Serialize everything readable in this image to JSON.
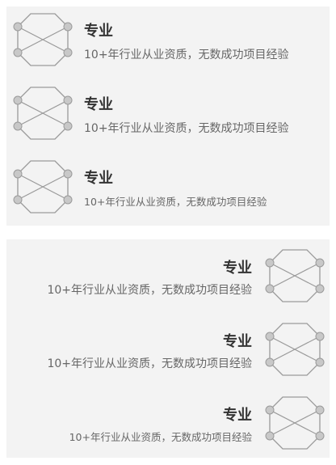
{
  "top_panel": {
    "items": [
      {
        "title": "专业",
        "desc": "10+年行业从业资质，无数成功项目经验"
      },
      {
        "title": "专业",
        "desc": "10+年行业从业资质，无数成功项目经验"
      },
      {
        "title": "专业",
        "desc": "10+年行业从业资质，无数成功项目经验"
      }
    ]
  },
  "bottom_panel": {
    "items": [
      {
        "title": "专业",
        "desc": "10+年行业从业资质，无数成功项目经验"
      },
      {
        "title": "专业",
        "desc": "10+年行业从业资质，无数成功项目经验"
      },
      {
        "title": "专业",
        "desc": "10+年行业从业资质，无数成功项目经验"
      }
    ]
  },
  "colors": {
    "panel_bg": "#f3f3f3",
    "icon_stroke": "#9a9a9a",
    "icon_node": "#c8c8c8",
    "title": "#333333",
    "desc": "#666666"
  },
  "icon": "hexagon-network-icon"
}
